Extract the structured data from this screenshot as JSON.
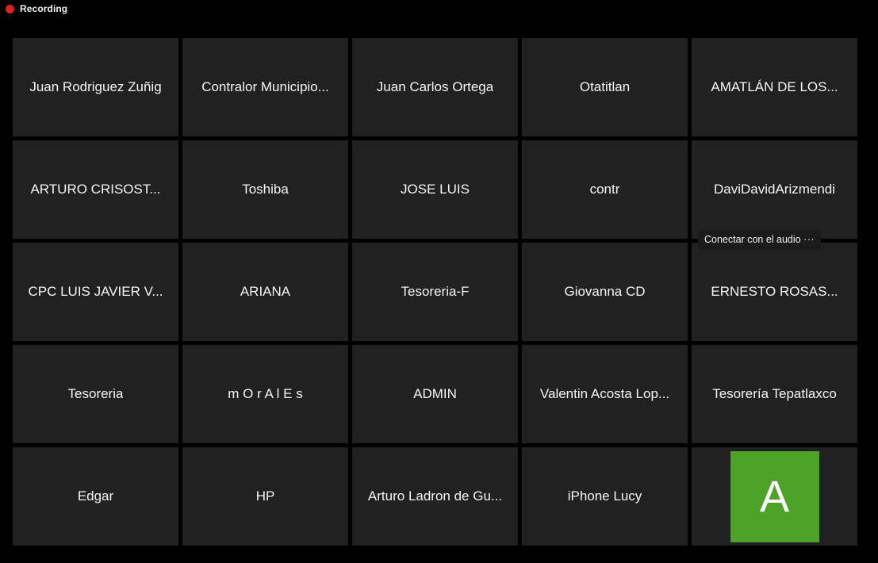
{
  "topbar": {
    "recording_label": "Recording",
    "recording_dot_color": "#e32020"
  },
  "theme": {
    "page_background": "#000000",
    "tile_background": "#212121",
    "tile_text_color": "#f5f5f5",
    "avatar_green": "#4ca328",
    "chip_background": "#1b1b1b"
  },
  "grid": {
    "columns": 5,
    "rows": 5,
    "tiles": [
      {
        "name": "Juan Rodriguez Zuñig",
        "type": "name"
      },
      {
        "name": "Contralor Municipio...",
        "type": "name"
      },
      {
        "name": "Juan Carlos Ortega",
        "type": "name"
      },
      {
        "name": "Otatitlan",
        "type": "name"
      },
      {
        "name": "AMATLÁN DE LOS...",
        "type": "name"
      },
      {
        "name": "ARTURO CRISOST...",
        "type": "name"
      },
      {
        "name": "Toshiba",
        "type": "name"
      },
      {
        "name": "JOSE LUIS",
        "type": "name"
      },
      {
        "name": "contr",
        "type": "name"
      },
      {
        "name": "DaviDavidArizmendi",
        "type": "name",
        "audio_chip": "Conectar con el audio",
        "audio_chip_ellipsis": "···"
      },
      {
        "name": "CPC LUIS JAVIER V...",
        "type": "name"
      },
      {
        "name": "ARIANA",
        "type": "name"
      },
      {
        "name": "Tesoreria-F",
        "type": "name"
      },
      {
        "name": "Giovanna CD",
        "type": "name"
      },
      {
        "name": "ERNESTO ROSAS...",
        "type": "name"
      },
      {
        "name": "Tesoreria",
        "type": "name"
      },
      {
        "name": "m O r A l E s",
        "type": "name"
      },
      {
        "name": "ADMIN",
        "type": "name"
      },
      {
        "name": "Valentin Acosta Lop...",
        "type": "name"
      },
      {
        "name": "Tesorería Tepatlaxco",
        "type": "name"
      },
      {
        "name": "Edgar",
        "type": "name"
      },
      {
        "name": "HP",
        "type": "name"
      },
      {
        "name": "Arturo Ladron de Gu...",
        "type": "name"
      },
      {
        "name": "iPhone Lucy",
        "type": "name"
      },
      {
        "name": "A",
        "type": "avatar"
      }
    ]
  }
}
